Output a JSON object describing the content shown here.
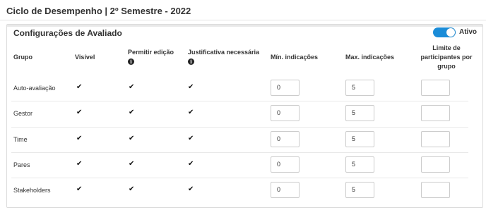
{
  "page": {
    "title": "Ciclo de Desempenho | 2º Semestre - 2022"
  },
  "panel": {
    "title": "Configurações de Avaliado",
    "toggle": {
      "label": "Ativo",
      "state": "on",
      "color": "#1a8cd8"
    }
  },
  "table": {
    "headers": {
      "grupo": "Grupo",
      "visivel": "Visível",
      "permitir": "Permitir edição",
      "justificativa": "Justificativa necessária",
      "min": "Mín. indicações",
      "max": "Max. indicações",
      "limite_l1": "Limite de",
      "limite_l2": "participantes por",
      "limite_l3": "grupo"
    },
    "info_icon": "info-circle-icon",
    "rows": [
      {
        "grupo": "Auto-avaliação",
        "visivel": true,
        "permitir": true,
        "justificativa": true,
        "min": "0",
        "max": "5",
        "limite": ""
      },
      {
        "grupo": "Gestor",
        "visivel": true,
        "permitir": true,
        "justificativa": true,
        "min": "0",
        "max": "5",
        "limite": ""
      },
      {
        "grupo": "Time",
        "visivel": true,
        "permitir": true,
        "justificativa": true,
        "min": "0",
        "max": "5",
        "limite": ""
      },
      {
        "grupo": "Pares",
        "visivel": true,
        "permitir": true,
        "justificativa": true,
        "min": "0",
        "max": "5",
        "limite": ""
      },
      {
        "grupo": "Stakeholders",
        "visivel": true,
        "permitir": true,
        "justificativa": true,
        "min": "0",
        "max": "5",
        "limite": ""
      }
    ]
  }
}
